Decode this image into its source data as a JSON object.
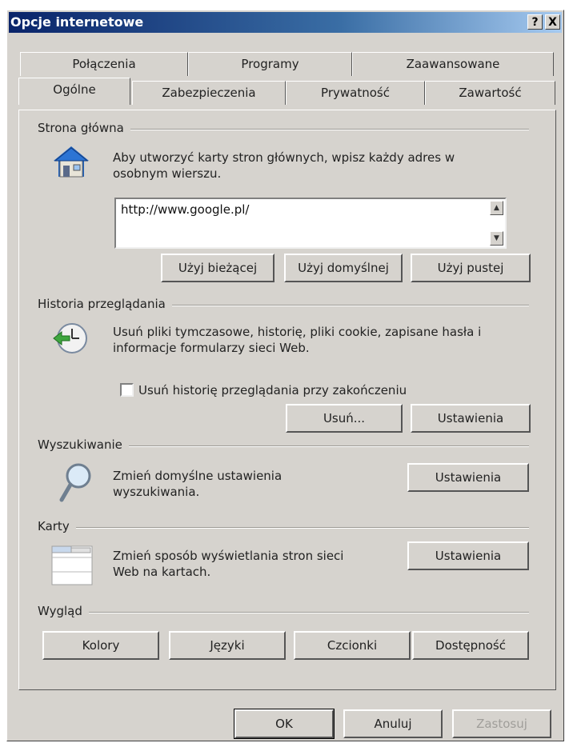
{
  "window": {
    "title": "Opcje internetowe",
    "help_button": "?",
    "close_button": "X"
  },
  "tabs_back": [
    "Połączenia",
    "Programy",
    "Zaawansowane"
  ],
  "tabs_front": [
    "Ogólne",
    "Zabezpieczenia",
    "Prywatność",
    "Zawartość"
  ],
  "home": {
    "title": "Strona główna",
    "text1": "Aby utworzyć karty stron głównych, wpisz każdy adres w",
    "text2": "osobnym wierszu.",
    "url": "http://www.google.pl/",
    "buttons": [
      "Użyj bieżącej",
      "Użyj domyślnej",
      "Użyj pustej"
    ]
  },
  "history": {
    "title": "Historia przeglądania",
    "text1": "Usuń pliki tymczasowe, historię, pliki cookie, zapisane hasła i",
    "text2": "informacje formularzy sieci Web.",
    "checkbox_label": "Usuń historię przeglądania przy zakończeniu",
    "delete_button": "Usuń...",
    "settings_button": "Ustawienia"
  },
  "search": {
    "title": "Wyszukiwanie",
    "text1": "Zmień domyślne ustawienia",
    "text2": "wyszukiwania.",
    "settings_button": "Ustawienia"
  },
  "tabs_group": {
    "title": "Karty",
    "text1": "Zmień sposób wyświetlania stron sieci",
    "text2": "Web na kartach.",
    "settings_button": "Ustawienia"
  },
  "appearance": {
    "title": "Wygląd",
    "buttons": [
      "Kolory",
      "Języki",
      "Czcionki",
      "Dostępność"
    ]
  },
  "footer": {
    "ok": "OK",
    "cancel": "Anuluj",
    "apply": "Zastosuj"
  },
  "icon_names": {
    "home": "home-icon",
    "history": "history-clock-icon",
    "search": "magnifier-icon",
    "tabs": "tabs-window-icon"
  }
}
